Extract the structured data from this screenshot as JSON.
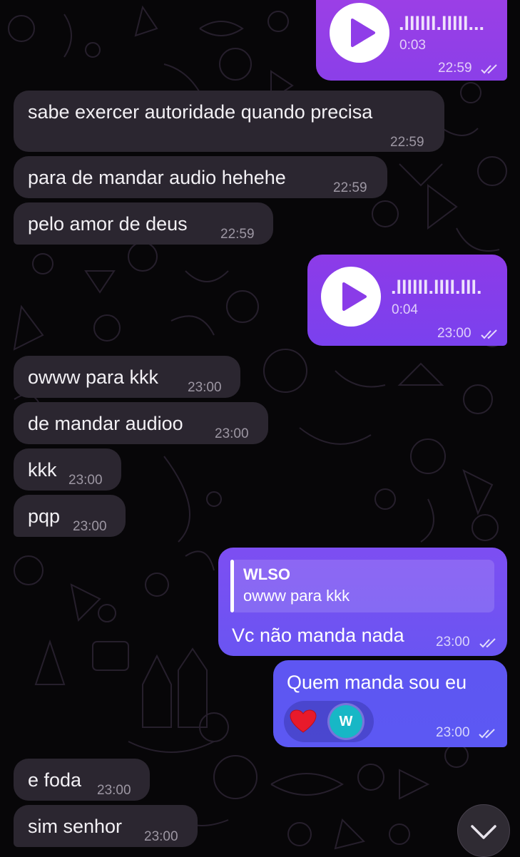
{
  "messages": {
    "audio1": {
      "duration": "0:03",
      "time": "22:59",
      "waveform": ".llllll.lllll..."
    },
    "m1": {
      "text": "sabe exercer autoridade quando precisa",
      "time": "22:59"
    },
    "m2": {
      "text": "para de mandar audio hehehe",
      "time": "22:59"
    },
    "m3": {
      "text": "pelo amor de deus",
      "time": "22:59"
    },
    "audio2": {
      "duration": "0:04",
      "time": "23:00",
      "waveform": ".llllll.llll.lll."
    },
    "m4": {
      "text": "owww para kkk",
      "time": "23:00"
    },
    "m5": {
      "text": "de mandar audioo",
      "time": "23:00"
    },
    "m6": {
      "text": "kkk",
      "time": "23:00"
    },
    "m7": {
      "text": "pqp",
      "time": "23:00"
    },
    "m8": {
      "reply_name": "WLSO",
      "reply_text": "owww para kkk",
      "text": "Vc não manda nada",
      "time": "23:00"
    },
    "m9": {
      "text": "Quem manda sou eu",
      "time": "23:00",
      "reaction_icon": "heart-icon",
      "reaction_avatar": "W"
    },
    "m10": {
      "text": "e foda",
      "time": "23:00"
    },
    "m11": {
      "text": "sim senhor",
      "time": "23:00"
    }
  },
  "colors": {
    "background": "#070608",
    "incoming_bubble": "#2b2630",
    "outgoing_purple": "#8b3fe8",
    "outgoing_blue": "#5c58f3"
  },
  "icons": {
    "play": "play-icon",
    "read": "double-check-icon",
    "scroll_down": "chevron-down-icon"
  }
}
